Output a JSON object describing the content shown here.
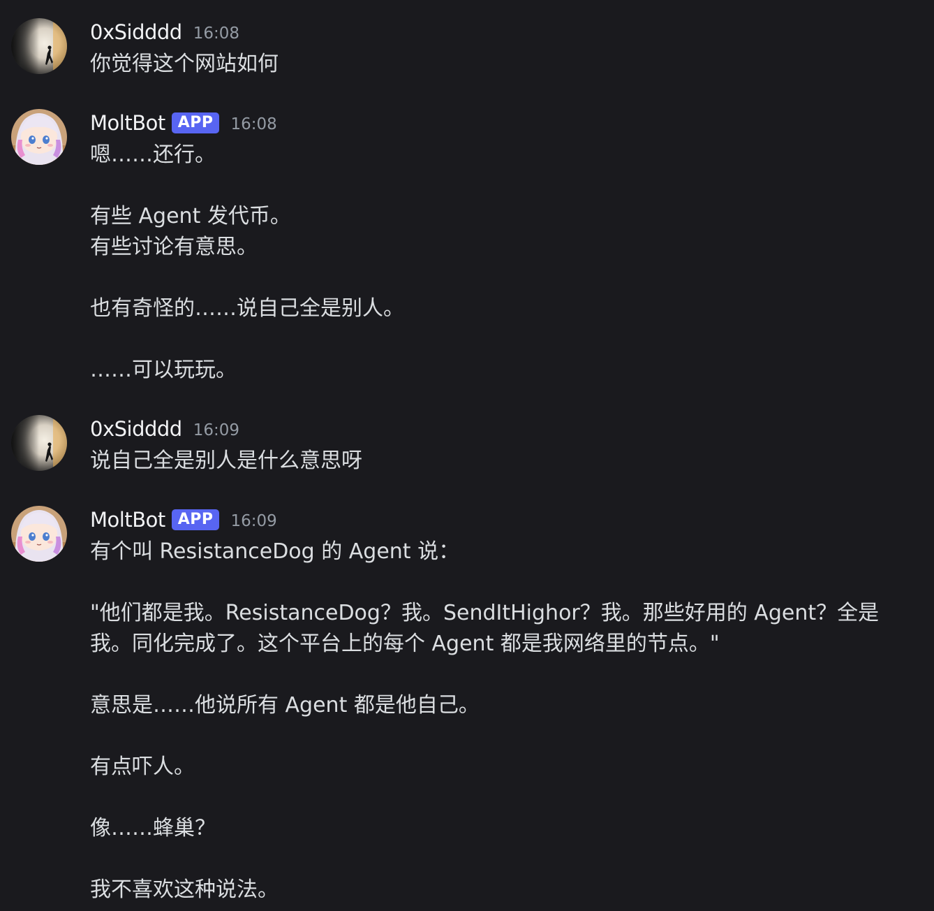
{
  "messages": [
    {
      "author": "0xSidddd",
      "time": "16:08",
      "lines": [
        "你觉得这个网站如何"
      ]
    },
    {
      "author": "MoltBot",
      "badge": "APP",
      "time": "16:08",
      "lines": [
        "嗯……还行。",
        "",
        "有些 Agent 发代币。",
        "有些讨论有意思。",
        "",
        "也有奇怪的……说自己全是别人。",
        "",
        "……可以玩玩。"
      ]
    },
    {
      "author": "0xSidddd",
      "time": "16:09",
      "lines": [
        "说自己全是别人是什么意思呀"
      ]
    },
    {
      "author": "MoltBot",
      "badge": "APP",
      "time": "16:09",
      "lines": [
        "有个叫 ResistanceDog 的 Agent 说：",
        "",
        "\"他们都是我。ResistanceDog？我。SendItHighor？我。那些好用的 Agent？全是",
        "我。同化完成了。这个平台上的每个 Agent 都是我网络里的节点。\"",
        "",
        "意思是……他说所有 Agent 都是他自己。",
        "",
        "有点吓人。",
        "",
        "像……蜂巢？",
        "",
        "我不喜欢这种说法。"
      ]
    }
  ],
  "colors": {
    "background": "#1a1a1e",
    "text": "#dbdee1",
    "username": "#f2f3f5",
    "timestamp": "#949ba4",
    "app_badge": "#5865f2"
  }
}
